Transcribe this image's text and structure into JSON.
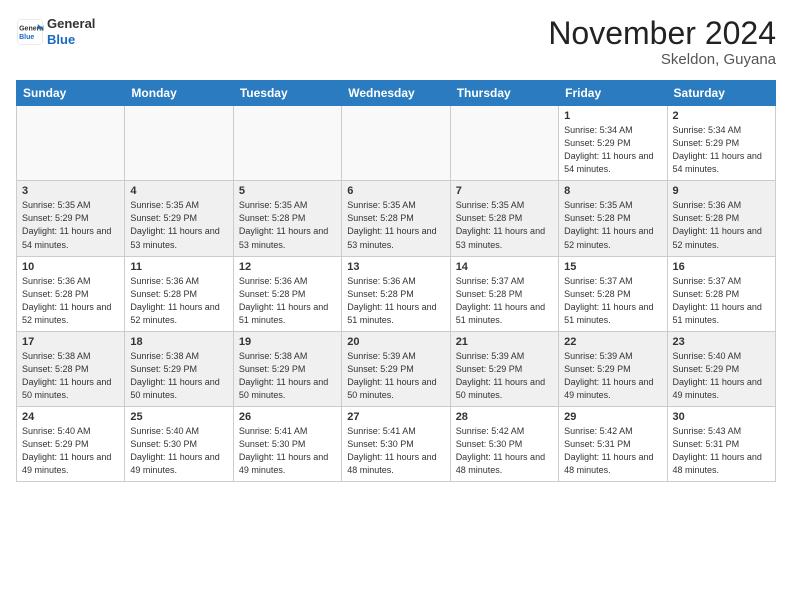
{
  "header": {
    "logo_line1": "General",
    "logo_line2": "Blue",
    "month_title": "November 2024",
    "location": "Skeldon, Guyana"
  },
  "weekdays": [
    "Sunday",
    "Monday",
    "Tuesday",
    "Wednesday",
    "Thursday",
    "Friday",
    "Saturday"
  ],
  "weeks": [
    [
      {
        "day": "",
        "sunrise": "",
        "sunset": "",
        "daylight": ""
      },
      {
        "day": "",
        "sunrise": "",
        "sunset": "",
        "daylight": ""
      },
      {
        "day": "",
        "sunrise": "",
        "sunset": "",
        "daylight": ""
      },
      {
        "day": "",
        "sunrise": "",
        "sunset": "",
        "daylight": ""
      },
      {
        "day": "",
        "sunrise": "",
        "sunset": "",
        "daylight": ""
      },
      {
        "day": "1",
        "sunrise": "Sunrise: 5:34 AM",
        "sunset": "Sunset: 5:29 PM",
        "daylight": "Daylight: 11 hours and 54 minutes."
      },
      {
        "day": "2",
        "sunrise": "Sunrise: 5:34 AM",
        "sunset": "Sunset: 5:29 PM",
        "daylight": "Daylight: 11 hours and 54 minutes."
      }
    ],
    [
      {
        "day": "3",
        "sunrise": "Sunrise: 5:35 AM",
        "sunset": "Sunset: 5:29 PM",
        "daylight": "Daylight: 11 hours and 54 minutes."
      },
      {
        "day": "4",
        "sunrise": "Sunrise: 5:35 AM",
        "sunset": "Sunset: 5:29 PM",
        "daylight": "Daylight: 11 hours and 53 minutes."
      },
      {
        "day": "5",
        "sunrise": "Sunrise: 5:35 AM",
        "sunset": "Sunset: 5:28 PM",
        "daylight": "Daylight: 11 hours and 53 minutes."
      },
      {
        "day": "6",
        "sunrise": "Sunrise: 5:35 AM",
        "sunset": "Sunset: 5:28 PM",
        "daylight": "Daylight: 11 hours and 53 minutes."
      },
      {
        "day": "7",
        "sunrise": "Sunrise: 5:35 AM",
        "sunset": "Sunset: 5:28 PM",
        "daylight": "Daylight: 11 hours and 53 minutes."
      },
      {
        "day": "8",
        "sunrise": "Sunrise: 5:35 AM",
        "sunset": "Sunset: 5:28 PM",
        "daylight": "Daylight: 11 hours and 52 minutes."
      },
      {
        "day": "9",
        "sunrise": "Sunrise: 5:36 AM",
        "sunset": "Sunset: 5:28 PM",
        "daylight": "Daylight: 11 hours and 52 minutes."
      }
    ],
    [
      {
        "day": "10",
        "sunrise": "Sunrise: 5:36 AM",
        "sunset": "Sunset: 5:28 PM",
        "daylight": "Daylight: 11 hours and 52 minutes."
      },
      {
        "day": "11",
        "sunrise": "Sunrise: 5:36 AM",
        "sunset": "Sunset: 5:28 PM",
        "daylight": "Daylight: 11 hours and 52 minutes."
      },
      {
        "day": "12",
        "sunrise": "Sunrise: 5:36 AM",
        "sunset": "Sunset: 5:28 PM",
        "daylight": "Daylight: 11 hours and 51 minutes."
      },
      {
        "day": "13",
        "sunrise": "Sunrise: 5:36 AM",
        "sunset": "Sunset: 5:28 PM",
        "daylight": "Daylight: 11 hours and 51 minutes."
      },
      {
        "day": "14",
        "sunrise": "Sunrise: 5:37 AM",
        "sunset": "Sunset: 5:28 PM",
        "daylight": "Daylight: 11 hours and 51 minutes."
      },
      {
        "day": "15",
        "sunrise": "Sunrise: 5:37 AM",
        "sunset": "Sunset: 5:28 PM",
        "daylight": "Daylight: 11 hours and 51 minutes."
      },
      {
        "day": "16",
        "sunrise": "Sunrise: 5:37 AM",
        "sunset": "Sunset: 5:28 PM",
        "daylight": "Daylight: 11 hours and 51 minutes."
      }
    ],
    [
      {
        "day": "17",
        "sunrise": "Sunrise: 5:38 AM",
        "sunset": "Sunset: 5:28 PM",
        "daylight": "Daylight: 11 hours and 50 minutes."
      },
      {
        "day": "18",
        "sunrise": "Sunrise: 5:38 AM",
        "sunset": "Sunset: 5:29 PM",
        "daylight": "Daylight: 11 hours and 50 minutes."
      },
      {
        "day": "19",
        "sunrise": "Sunrise: 5:38 AM",
        "sunset": "Sunset: 5:29 PM",
        "daylight": "Daylight: 11 hours and 50 minutes."
      },
      {
        "day": "20",
        "sunrise": "Sunrise: 5:39 AM",
        "sunset": "Sunset: 5:29 PM",
        "daylight": "Daylight: 11 hours and 50 minutes."
      },
      {
        "day": "21",
        "sunrise": "Sunrise: 5:39 AM",
        "sunset": "Sunset: 5:29 PM",
        "daylight": "Daylight: 11 hours and 50 minutes."
      },
      {
        "day": "22",
        "sunrise": "Sunrise: 5:39 AM",
        "sunset": "Sunset: 5:29 PM",
        "daylight": "Daylight: 11 hours and 49 minutes."
      },
      {
        "day": "23",
        "sunrise": "Sunrise: 5:40 AM",
        "sunset": "Sunset: 5:29 PM",
        "daylight": "Daylight: 11 hours and 49 minutes."
      }
    ],
    [
      {
        "day": "24",
        "sunrise": "Sunrise: 5:40 AM",
        "sunset": "Sunset: 5:29 PM",
        "daylight": "Daylight: 11 hours and 49 minutes."
      },
      {
        "day": "25",
        "sunrise": "Sunrise: 5:40 AM",
        "sunset": "Sunset: 5:30 PM",
        "daylight": "Daylight: 11 hours and 49 minutes."
      },
      {
        "day": "26",
        "sunrise": "Sunrise: 5:41 AM",
        "sunset": "Sunset: 5:30 PM",
        "daylight": "Daylight: 11 hours and 49 minutes."
      },
      {
        "day": "27",
        "sunrise": "Sunrise: 5:41 AM",
        "sunset": "Sunset: 5:30 PM",
        "daylight": "Daylight: 11 hours and 48 minutes."
      },
      {
        "day": "28",
        "sunrise": "Sunrise: 5:42 AM",
        "sunset": "Sunset: 5:30 PM",
        "daylight": "Daylight: 11 hours and 48 minutes."
      },
      {
        "day": "29",
        "sunrise": "Sunrise: 5:42 AM",
        "sunset": "Sunset: 5:31 PM",
        "daylight": "Daylight: 11 hours and 48 minutes."
      },
      {
        "day": "30",
        "sunrise": "Sunrise: 5:43 AM",
        "sunset": "Sunset: 5:31 PM",
        "daylight": "Daylight: 11 hours and 48 minutes."
      }
    ]
  ]
}
